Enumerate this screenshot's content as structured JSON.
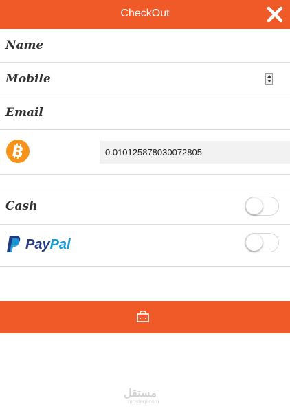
{
  "header": {
    "title": "CheckOut"
  },
  "form": {
    "name_label": "Name",
    "mobile_label": "Mobile",
    "email_label": "Email",
    "btc_value": "0.010125878030072805"
  },
  "payment": {
    "cash_label": "Cash",
    "paypal_pay": "Pay",
    "paypal_pal": "Pal"
  },
  "watermark": {
    "main": "مستقل",
    "sub": "mostaql.com"
  },
  "colors": {
    "accent": "#ef5a28",
    "bitcoin": "#f7931a",
    "paypal_dark": "#253b80",
    "paypal_light": "#179bd7"
  }
}
